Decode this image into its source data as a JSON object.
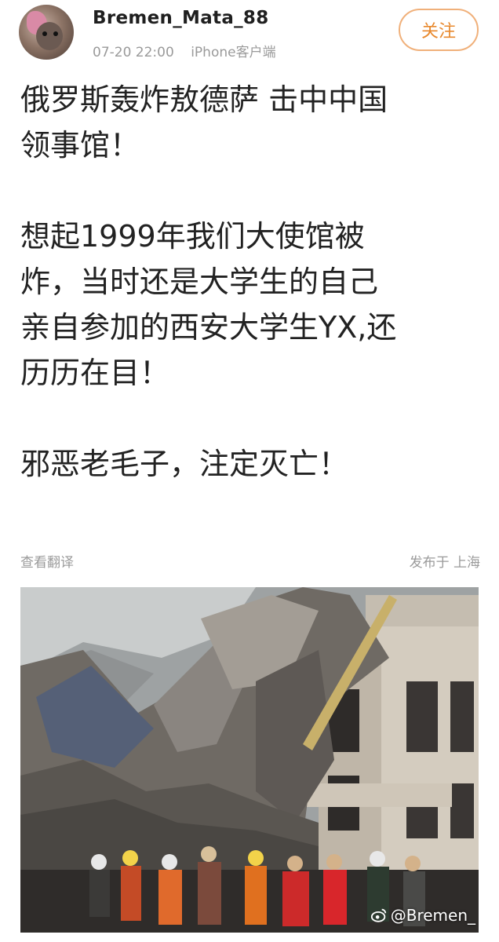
{
  "header": {
    "username": "Bremen_Mata_88",
    "date": "07-20 22:00",
    "source": "iPhone客户端",
    "follow_label": "关注"
  },
  "post": {
    "paragraph1": [
      "俄罗斯轰炸敖德萨 击中中国",
      "领事馆！"
    ],
    "paragraph2": [
      "想起1999年我们大使馆被",
      "炸，当时还是大学生的自己",
      "亲自参加的西安大学生YX,还",
      "历历在目！"
    ],
    "paragraph3": [
      "邪恶老毛子，注定灭亡！"
    ]
  },
  "footer": {
    "translate_label": "查看翻译",
    "location_label": "发布于 上海"
  },
  "photo": {
    "watermark_text": "@Bremen_",
    "watermark_icon": "weibo-icon"
  },
  "colors": {
    "follow_accent": "#e8892e",
    "meta_gray": "#9a9a9a"
  }
}
